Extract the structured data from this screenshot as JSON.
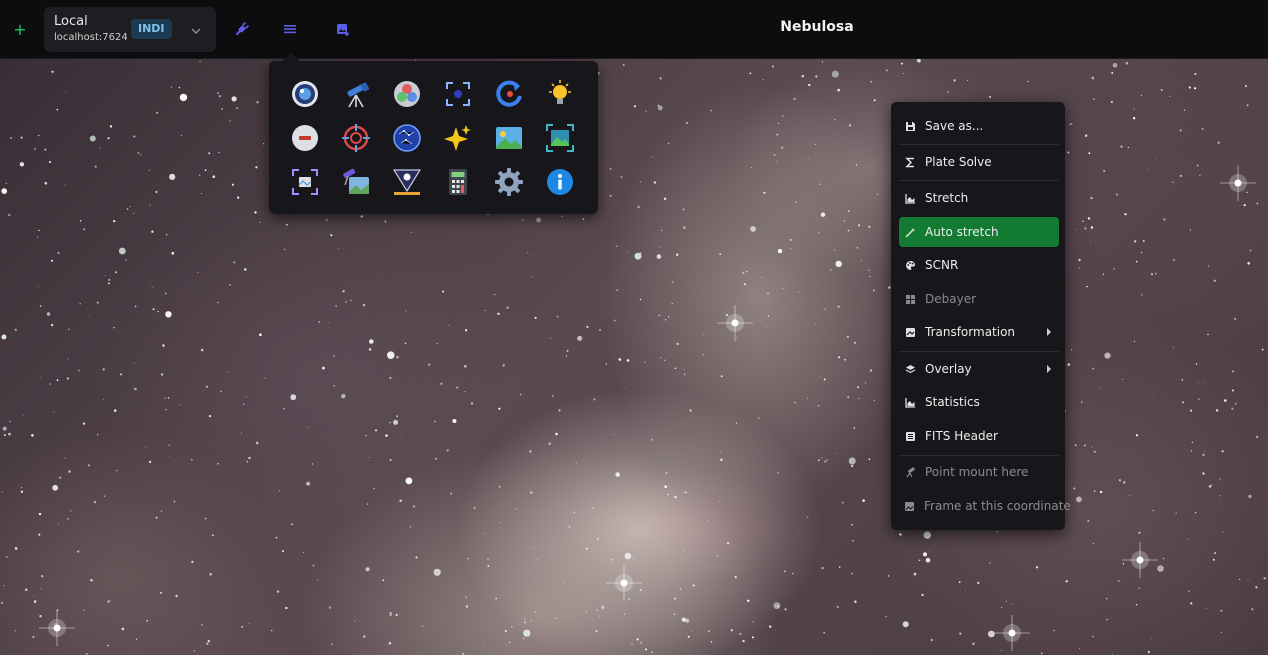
{
  "topbar": {
    "connection": {
      "name": "Local",
      "host": "localhost:7624",
      "badge": "INDI"
    },
    "title": "Nebulosa",
    "icons": [
      "add-icon",
      "plug-icon",
      "menu-icon",
      "image-add-icon",
      "chevron-down-icon"
    ],
    "colors": {
      "add": "#23c55e",
      "nav_icons": "#5b5fe6",
      "badge_bg": "#1c3a52",
      "badge_text": "#7fc4ee"
    }
  },
  "apps_popup": {
    "rows": [
      [
        "camera-icon",
        "telescope-icon",
        "color-filter-wheel-icon",
        "focus-target-icon",
        "rotator-icon",
        "light-bulb-icon"
      ],
      [
        "cover-icon",
        "crosshair-guider-icon",
        "sky-atlas-icon",
        "stars-sparkle-icon",
        "image-viewer-icon",
        "framing-icon"
      ],
      [
        "alignment-icon",
        "mount-image-icon",
        "indi-logo-icon",
        "calculator-icon",
        "settings-gear-icon",
        "about-info-icon"
      ]
    ]
  },
  "context_menu": {
    "items": [
      {
        "label": "Save as...",
        "icon": "save-icon",
        "enabled": true,
        "active": false,
        "submenu": false
      },
      {
        "label": "Plate Solve",
        "icon": "sigma-icon",
        "enabled": true,
        "active": false,
        "submenu": false
      },
      {
        "label": "Stretch",
        "icon": "histogram-icon",
        "enabled": true,
        "active": false,
        "submenu": false
      },
      {
        "label": "Auto stretch",
        "icon": "magic-wand-icon",
        "enabled": true,
        "active": true,
        "submenu": false
      },
      {
        "label": "SCNR",
        "icon": "palette-icon",
        "enabled": true,
        "active": false,
        "submenu": false
      },
      {
        "label": "Debayer",
        "icon": "grid-icon",
        "enabled": false,
        "active": false,
        "submenu": false
      },
      {
        "label": "Transformation",
        "icon": "image-edit-icon",
        "enabled": true,
        "active": false,
        "submenu": true
      },
      {
        "label": "Overlay",
        "icon": "layers-icon",
        "enabled": true,
        "active": false,
        "submenu": true
      },
      {
        "label": "Statistics",
        "icon": "chart-icon",
        "enabled": true,
        "active": false,
        "submenu": false
      },
      {
        "label": "FITS Header",
        "icon": "list-icon",
        "enabled": true,
        "active": false,
        "submenu": false
      },
      {
        "label": "Point mount here",
        "icon": "telescope-small-icon",
        "enabled": false,
        "active": false,
        "submenu": false
      },
      {
        "label": "Frame at this coordinate",
        "icon": "frame-image-icon",
        "enabled": false,
        "active": false,
        "submenu": false
      }
    ],
    "colors": {
      "active_bg": "#137a32",
      "menu_bg": "#17171b"
    }
  }
}
